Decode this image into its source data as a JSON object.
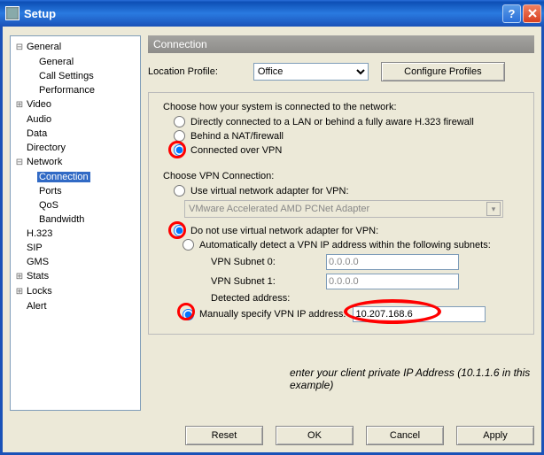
{
  "window": {
    "title": "Setup"
  },
  "tree": {
    "general": {
      "label": "General",
      "general": "General",
      "call": "Call Settings",
      "perf": "Performance"
    },
    "video": "Video",
    "audio": "Audio",
    "data": "Data",
    "directory": "Directory",
    "network": {
      "label": "Network",
      "connection": "Connection",
      "ports": "Ports",
      "qos": "QoS",
      "bandwidth": "Bandwidth"
    },
    "h323": "H.323",
    "sip": "SIP",
    "gms": "GMS",
    "stats": "Stats",
    "locks": "Locks",
    "alert": "Alert"
  },
  "panel": {
    "title": "Connection",
    "locprofile_label": "Location Profile:",
    "locprofile_value": "Office",
    "configure_label": "Configure Profiles",
    "group1": {
      "prompt": "Choose how your system is connected to the network:",
      "opt1": "Directly connected to a LAN or behind a fully aware H.323 firewall",
      "opt2": "Behind a NAT/firewall",
      "opt3": "Connected over VPN"
    },
    "group2": {
      "prompt": "Choose VPN Connection:",
      "use_virtual": "Use virtual network adapter for VPN:",
      "adapter": "VMware Accelerated AMD PCNet Adapter",
      "not_virtual": "Do not use virtual network adapter for VPN:",
      "auto": "Automatically detect a VPN IP address within the following subnets:",
      "subnet0_label": "VPN Subnet 0:",
      "subnet0_value": "0.0.0.0",
      "subnet1_label": "VPN Subnet 1:",
      "subnet1_value": "0.0.0.0",
      "detected_label": "Detected address:",
      "manual": "Manually specify VPN IP address:",
      "manual_value": "10.207.168.6"
    }
  },
  "caption": "enter your client private IP Address (10.1.1.6 in this example)",
  "buttons": {
    "reset": "Reset",
    "ok": "OK",
    "cancel": "Cancel",
    "apply": "Apply"
  }
}
